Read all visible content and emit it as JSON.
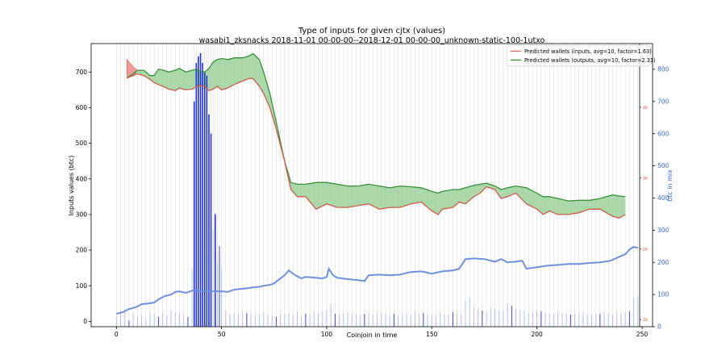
{
  "chart_data": {
    "type": "line",
    "title": "Type of inputs for given cjtx (values)",
    "subtitle": "wasabi1_zksnacks 2018-11-01 00-00-00--2018-12-01 00-00-00_unknown-static-100-1utxo",
    "xlabel": "Coinjoin in time",
    "ylabel": "Inputs values (btc)",
    "y2label": "btc in mix",
    "xlim": [
      -12,
      255
    ],
    "ylim": [
      -15,
      780
    ],
    "y2lim": [
      0,
      880
    ],
    "y3lim": [
      9,
      49
    ],
    "x_ticks": [
      "0",
      "50",
      "100",
      "150",
      "200",
      "250"
    ],
    "y_ticks": [
      "0",
      "100",
      "200",
      "300",
      "400",
      "500",
      "600",
      "700"
    ],
    "y2_ticks": [
      "0",
      "100",
      "200",
      "300",
      "400",
      "500",
      "600",
      "700",
      "800"
    ],
    "y3_ticks": [
      "10",
      "20",
      "30",
      "40"
    ],
    "legend_position": "top-right",
    "legend": [
      {
        "label": "Predicted wallets (inputs, avg=10, factor=1.63)",
        "color": "#e07060"
      },
      {
        "label": "Predicted wallets (outputs, avg=10, factor=2.31)",
        "color": "#3a9a3a"
      }
    ],
    "colors": {
      "inputs_line": "#d05a48",
      "inputs_fill": "#f08080",
      "outputs_line": "#3a8f3a",
      "outputs_fill": "#8fcc8f",
      "mix_line": "#6f8fe0",
      "bars_light": "#aab6ee",
      "bars_dark": "#2233cc",
      "grid_vlines": "#d8d8d8"
    },
    "series": [
      {
        "name": "Predicted wallets (inputs, avg=10, factor=1.63)",
        "x": [
          5,
          8,
          10,
          13,
          16,
          18,
          20,
          22,
          25,
          28,
          30,
          33,
          36,
          38,
          40,
          42,
          44,
          46,
          48,
          50,
          53,
          56,
          60,
          63,
          65,
          68,
          70,
          73,
          76,
          80,
          83,
          86,
          90,
          95,
          100,
          105,
          110,
          115,
          120,
          125,
          130,
          135,
          140,
          145,
          150,
          153,
          155,
          160,
          163,
          166,
          170,
          173,
          176,
          180,
          183,
          186,
          190,
          195,
          200,
          203,
          206,
          210,
          215,
          220,
          225,
          230,
          233,
          236,
          239,
          242
        ],
        "values": [
          683,
          690,
          695,
          690,
          680,
          670,
          665,
          660,
          652,
          648,
          655,
          650,
          652,
          658,
          662,
          660,
          648,
          652,
          660,
          650,
          655,
          665,
          675,
          682,
          682,
          660,
          640,
          600,
          540,
          450,
          370,
          350,
          350,
          315,
          330,
          320,
          320,
          325,
          330,
          315,
          320,
          320,
          330,
          335,
          310,
          300,
          315,
          320,
          335,
          330,
          350,
          360,
          378,
          370,
          345,
          350,
          360,
          330,
          315,
          300,
          310,
          300,
          300,
          305,
          315,
          315,
          305,
          295,
          290,
          300
        ]
      },
      {
        "name": "Predicted wallets (outputs, avg=10, factor=2.31)",
        "x": [
          5,
          8,
          10,
          13,
          16,
          18,
          20,
          22,
          25,
          28,
          30,
          33,
          36,
          38,
          40,
          42,
          44,
          46,
          48,
          50,
          53,
          56,
          60,
          63,
          65,
          68,
          70,
          73,
          76,
          80,
          83,
          86,
          90,
          95,
          100,
          105,
          110,
          115,
          120,
          125,
          130,
          135,
          140,
          145,
          150,
          153,
          155,
          160,
          163,
          166,
          170,
          173,
          176,
          180,
          183,
          186,
          190,
          195,
          200,
          203,
          206,
          210,
          215,
          220,
          225,
          230,
          233,
          236,
          239,
          242
        ],
        "values": [
          683,
          695,
          705,
          705,
          690,
          690,
          708,
          706,
          700,
          705,
          710,
          700,
          705,
          708,
          702,
          700,
          710,
          728,
          735,
          738,
          735,
          740,
          740,
          745,
          752,
          735,
          700,
          640,
          560,
          450,
          390,
          385,
          385,
          390,
          390,
          385,
          380,
          380,
          385,
          380,
          375,
          380,
          378,
          375,
          365,
          360,
          365,
          370,
          370,
          375,
          382,
          385,
          388,
          380,
          370,
          375,
          380,
          375,
          360,
          350,
          350,
          345,
          338,
          340,
          340,
          345,
          350,
          355,
          352,
          350
        ]
      },
      {
        "name": "btc in mix",
        "axis": "right",
        "x": [
          0,
          3,
          6,
          9,
          12,
          15,
          18,
          20,
          23,
          26,
          28,
          30,
          33,
          36,
          38,
          40,
          43,
          46,
          48,
          50,
          53,
          56,
          60,
          63,
          65,
          68,
          70,
          73,
          75,
          78,
          80,
          82,
          85,
          88,
          90,
          95,
          98,
          100,
          101,
          103,
          105,
          110,
          115,
          118,
          120,
          125,
          130,
          135,
          140,
          145,
          150,
          155,
          160,
          163,
          166,
          170,
          175,
          180,
          183,
          186,
          190,
          193,
          195,
          200,
          205,
          210,
          215,
          220,
          225,
          230,
          235,
          240,
          242,
          244,
          246,
          248
        ],
        "values": [
          40,
          45,
          55,
          60,
          70,
          72,
          75,
          85,
          95,
          100,
          108,
          110,
          105,
          112,
          114,
          110,
          110,
          110,
          110,
          110,
          108,
          115,
          118,
          120,
          122,
          124,
          127,
          130,
          135,
          150,
          160,
          175,
          160,
          150,
          155,
          152,
          150,
          155,
          180,
          160,
          152,
          148,
          145,
          142,
          160,
          162,
          160,
          162,
          170,
          172,
          165,
          172,
          175,
          180,
          210,
          212,
          210,
          202,
          210,
          200,
          202,
          205,
          180,
          185,
          190,
          192,
          195,
          195,
          198,
          200,
          205,
          220,
          225,
          240,
          248,
          245
        ]
      }
    ],
    "bars": {
      "axis": "right",
      "x": [
        0,
        2,
        4,
        6,
        8,
        10,
        12,
        14,
        16,
        18,
        20,
        22,
        24,
        26,
        28,
        30,
        32,
        34,
        36,
        37,
        38,
        39,
        40,
        41,
        42,
        43,
        44,
        45,
        46,
        47,
        48,
        49,
        50,
        52,
        54,
        56,
        58,
        60,
        62,
        64,
        66,
        68,
        70,
        72,
        74,
        76,
        78,
        80,
        82,
        84,
        86,
        88,
        90,
        92,
        94,
        96,
        98,
        100,
        102,
        104,
        106,
        108,
        110,
        112,
        114,
        116,
        118,
        120,
        122,
        124,
        126,
        128,
        130,
        132,
        134,
        136,
        138,
        140,
        142,
        144,
        146,
        148,
        150,
        152,
        154,
        156,
        158,
        160,
        162,
        164,
        166,
        168,
        170,
        172,
        174,
        176,
        178,
        180,
        182,
        184,
        186,
        188,
        190,
        192,
        194,
        196,
        198,
        200,
        202,
        204,
        206,
        208,
        210,
        212,
        214,
        216,
        218,
        220,
        222,
        224,
        226,
        228,
        230,
        232,
        234,
        236,
        238,
        240,
        242,
        244,
        246,
        248
      ],
      "values": [
        35,
        48,
        52,
        20,
        40,
        30,
        35,
        25,
        45,
        40,
        30,
        42,
        35,
        50,
        45,
        40,
        35,
        30,
        180,
        700,
        820,
        840,
        850,
        820,
        790,
        780,
        660,
        600,
        300,
        350,
        200,
        250,
        180,
        50,
        40,
        45,
        38,
        45,
        42,
        40,
        35,
        38,
        45,
        40,
        35,
        30,
        38,
        40,
        42,
        38,
        45,
        35,
        40,
        38,
        45,
        42,
        48,
        55,
        70,
        40,
        38,
        42,
        45,
        40,
        38,
        35,
        40,
        42,
        38,
        40,
        45,
        42,
        38,
        40,
        35,
        42,
        40,
        38,
        45,
        40,
        42,
        38,
        40,
        35,
        42,
        38,
        40,
        45,
        42,
        40,
        80,
        90,
        60,
        55,
        50,
        45,
        60,
        55,
        50,
        48,
        70,
        65,
        55,
        50,
        48,
        42,
        45,
        50,
        48,
        45,
        42,
        40,
        45,
        42,
        40,
        38,
        40,
        42,
        45,
        40,
        38,
        42,
        40,
        45,
        42,
        38,
        40,
        42,
        45,
        48,
        90,
        95
      ]
    }
  }
}
